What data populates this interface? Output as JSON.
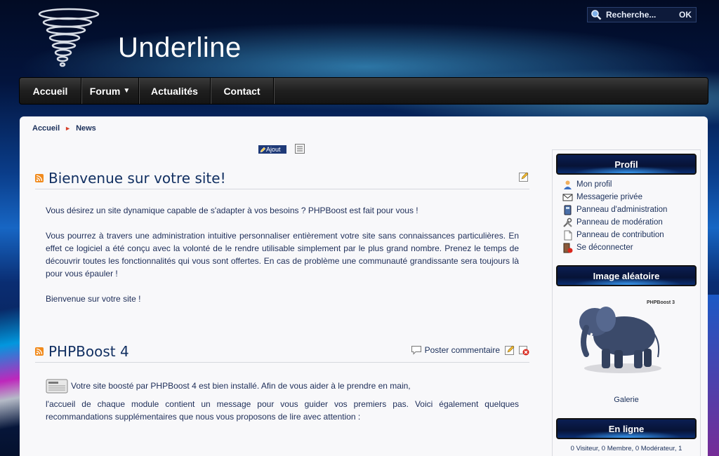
{
  "header": {
    "site_title": "Underline",
    "search_placeholder": "Recherche...",
    "search_button": "OK"
  },
  "nav": {
    "items": [
      {
        "label": "Accueil"
      },
      {
        "label": "Forum"
      },
      {
        "label": "Actualités"
      },
      {
        "label": "Contact"
      }
    ]
  },
  "breadcrumb": [
    "Accueil",
    "News"
  ],
  "toolbar": {
    "add_label": "Ajout"
  },
  "articles": [
    {
      "title": "Bienvenue sur votre site!",
      "paragraphs": [
        "Vous désirez un site dynamique capable de s'adapter à vos besoins ? PHPBoost est fait pour vous !",
        "Vous pourrez à travers une administration intuitive personnaliser entièrement votre site sans connaissances particulières. En effet ce logiciel a été conçu avec la volonté de le rendre utilisable simplement par le plus grand nombre. Prenez le temps de découvrir toutes les fonctionnalités qui vous sont offertes. En cas de problème une communauté grandissante sera toujours là pour vous épauler !",
        "Bienvenue sur votre site !"
      ]
    },
    {
      "title": "PHPBoost 4",
      "comment_label": "Poster commentaire",
      "intro": "Votre site boosté par PHPBoost 4 est bien installé. Afin de vous aider à le prendre en main,",
      "paragraph": "l'accueil de chaque module contient un message pour vous guider vos premiers pas. Voici également quelques recommandations supplémentaires que nous vous proposons de lire avec attention :"
    }
  ],
  "sidebar": {
    "profile": {
      "title": "Profil",
      "links": [
        {
          "label": "Mon profil",
          "icon": "user-icon"
        },
        {
          "label": "Messagerie privée",
          "icon": "envelope-icon"
        },
        {
          "label": "Panneau d'administration",
          "icon": "admin-icon"
        },
        {
          "label": "Panneau de modération",
          "icon": "tools-icon"
        },
        {
          "label": "Panneau de contribution",
          "icon": "document-icon"
        },
        {
          "label": "Se déconnecter",
          "icon": "logout-icon"
        }
      ]
    },
    "random_image": {
      "title": "Image aléatoire",
      "watermark": "PHPBoost 3",
      "gallery_label": "Galerie"
    },
    "online": {
      "title": "En ligne",
      "summary": "0 Visiteur, 0 Membre, 0 Modérateur, 1"
    }
  },
  "colors": {
    "title_blue": "#123062",
    "text_blue": "#1d2d58",
    "nav_bg": "#1f1f1f"
  }
}
